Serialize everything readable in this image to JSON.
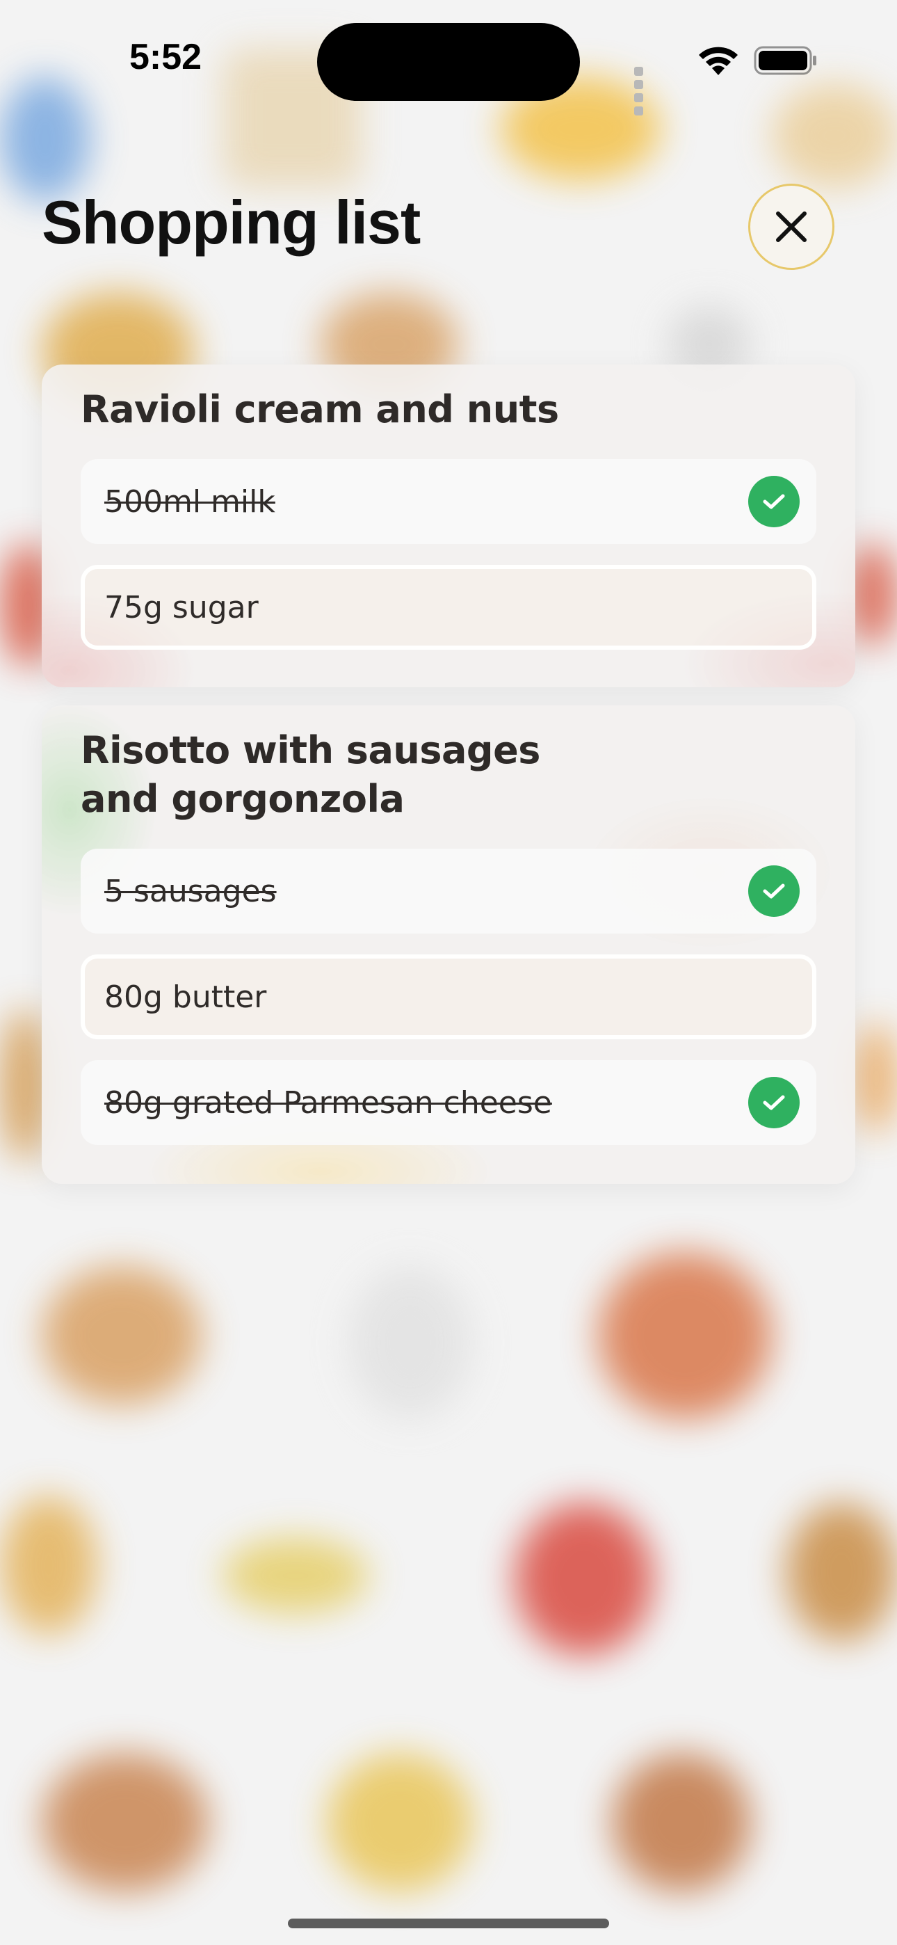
{
  "status_bar": {
    "time": "5:52",
    "icons": [
      "signal-icon",
      "wifi-icon",
      "battery-icon"
    ]
  },
  "header": {
    "title": "Shopping list",
    "close_icon": "close-icon"
  },
  "recipes": [
    {
      "title": "Ravioli cream and nuts",
      "items": [
        {
          "text": "500ml milk",
          "checked": true
        },
        {
          "text": "75g sugar",
          "checked": false
        }
      ]
    },
    {
      "title_lines": [
        "Risotto with sausages",
        "and gorgonzola"
      ],
      "items": [
        {
          "text": "5 sausages",
          "checked": true
        },
        {
          "text": "80g butter",
          "checked": false
        },
        {
          "text": "80g grated Parmesan cheese",
          "checked": true
        }
      ]
    }
  ],
  "colors": {
    "accent_check": "#2fb160",
    "close_ring": "#e7c86a",
    "background": "#f3f3f3"
  }
}
